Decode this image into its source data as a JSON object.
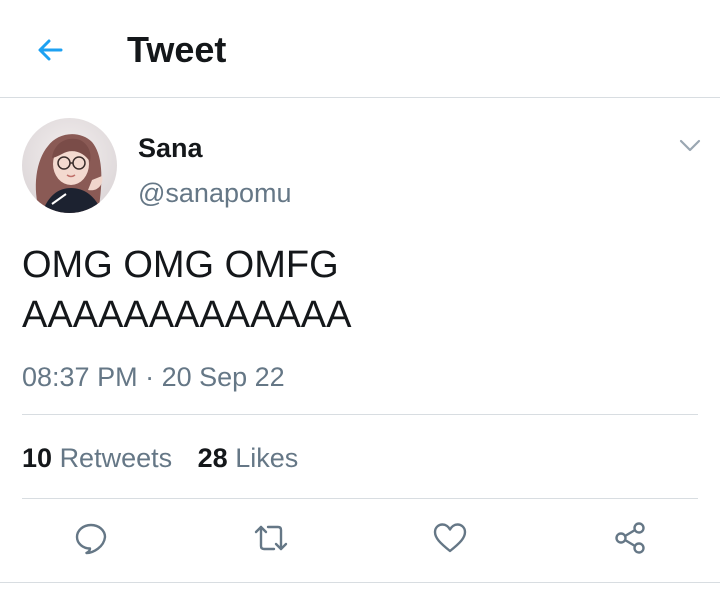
{
  "header": {
    "back_icon": "back-arrow-icon",
    "title": "Tweet"
  },
  "author": {
    "name": "Sana",
    "handle": "@sanapomu",
    "avatar_icon": "profile-photo"
  },
  "tweet": {
    "lines": [
      "OMG OMG OMFG",
      "AAAAAAAAAAAAA"
    ],
    "time": "08:37 PM",
    "separator": " · ",
    "date": "20 Sep 22"
  },
  "stats": {
    "retweets_count": "10",
    "retweets_label": "Retweets",
    "likes_count": "28",
    "likes_label": "Likes"
  },
  "actions": [
    "reply-icon",
    "retweet-icon",
    "like-icon",
    "share-icon"
  ],
  "colors": {
    "accent": "#1da1f2",
    "text": "#14171a",
    "secondary": "#657786",
    "divider": "#d8dde1"
  }
}
